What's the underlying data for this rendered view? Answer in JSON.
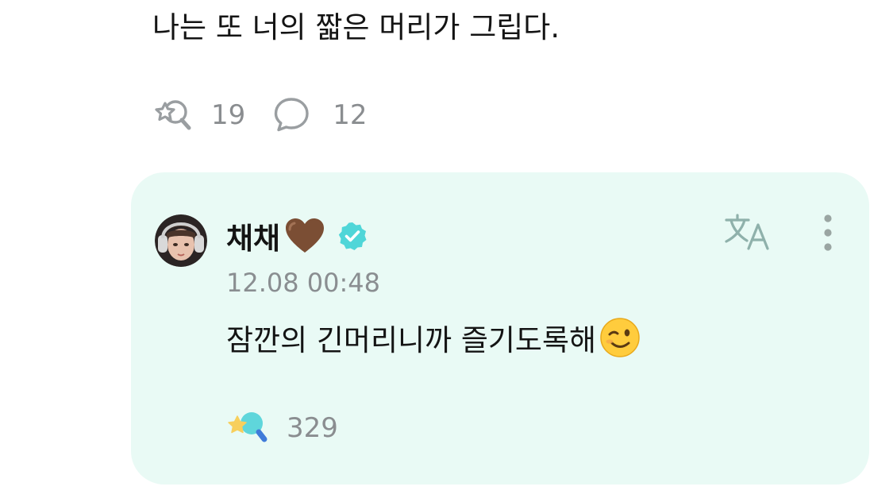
{
  "post": {
    "text": "나는 또 너의 짧은 머리가 그립다.",
    "like_count": "19",
    "comment_count": "12",
    "icons": {
      "like": "star-wand-icon",
      "comment": "speech-bubble-icon"
    }
  },
  "comment": {
    "author": "채채",
    "author_emoji": "brown-heart-icon",
    "verified_badge": "verified-check-icon",
    "timestamp": "12.08 00:48",
    "text": "잠깐의 긴머리니까 즐기도록해",
    "text_emoji": "winking-face-icon",
    "reaction_count": "329",
    "icons": {
      "translate": "translate-icon",
      "more": "more-vertical-icon",
      "reaction": "star-wand-filled-icon"
    }
  },
  "colors": {
    "card_background": "#e9faf5",
    "accent_teal": "#4fd6d8",
    "muted_text": "#8a8d90",
    "icon_gray": "#9a9ea1",
    "translate_icon": "#8fb1ab"
  }
}
